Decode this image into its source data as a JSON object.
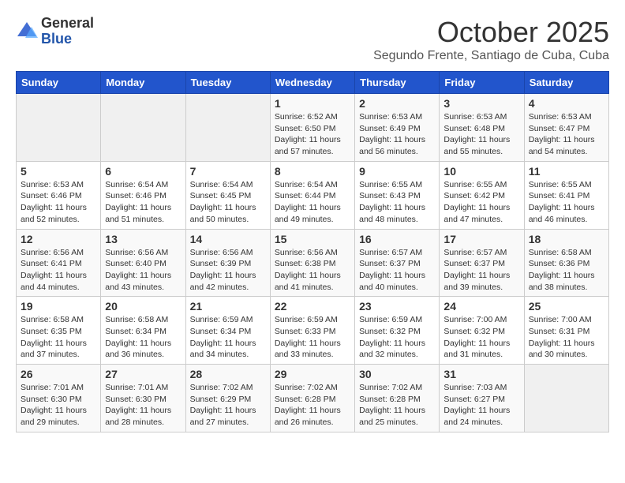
{
  "logo": {
    "general": "General",
    "blue": "Blue"
  },
  "title": "October 2025",
  "subtitle": "Segundo Frente, Santiago de Cuba, Cuba",
  "days_of_week": [
    "Sunday",
    "Monday",
    "Tuesday",
    "Wednesday",
    "Thursday",
    "Friday",
    "Saturday"
  ],
  "weeks": [
    [
      {
        "day": "",
        "info": ""
      },
      {
        "day": "",
        "info": ""
      },
      {
        "day": "",
        "info": ""
      },
      {
        "day": "1",
        "info": "Sunrise: 6:52 AM\nSunset: 6:50 PM\nDaylight: 11 hours\nand 57 minutes."
      },
      {
        "day": "2",
        "info": "Sunrise: 6:53 AM\nSunset: 6:49 PM\nDaylight: 11 hours\nand 56 minutes."
      },
      {
        "day": "3",
        "info": "Sunrise: 6:53 AM\nSunset: 6:48 PM\nDaylight: 11 hours\nand 55 minutes."
      },
      {
        "day": "4",
        "info": "Sunrise: 6:53 AM\nSunset: 6:47 PM\nDaylight: 11 hours\nand 54 minutes."
      }
    ],
    [
      {
        "day": "5",
        "info": "Sunrise: 6:53 AM\nSunset: 6:46 PM\nDaylight: 11 hours\nand 52 minutes."
      },
      {
        "day": "6",
        "info": "Sunrise: 6:54 AM\nSunset: 6:46 PM\nDaylight: 11 hours\nand 51 minutes."
      },
      {
        "day": "7",
        "info": "Sunrise: 6:54 AM\nSunset: 6:45 PM\nDaylight: 11 hours\nand 50 minutes."
      },
      {
        "day": "8",
        "info": "Sunrise: 6:54 AM\nSunset: 6:44 PM\nDaylight: 11 hours\nand 49 minutes."
      },
      {
        "day": "9",
        "info": "Sunrise: 6:55 AM\nSunset: 6:43 PM\nDaylight: 11 hours\nand 48 minutes."
      },
      {
        "day": "10",
        "info": "Sunrise: 6:55 AM\nSunset: 6:42 PM\nDaylight: 11 hours\nand 47 minutes."
      },
      {
        "day": "11",
        "info": "Sunrise: 6:55 AM\nSunset: 6:41 PM\nDaylight: 11 hours\nand 46 minutes."
      }
    ],
    [
      {
        "day": "12",
        "info": "Sunrise: 6:56 AM\nSunset: 6:41 PM\nDaylight: 11 hours\nand 44 minutes."
      },
      {
        "day": "13",
        "info": "Sunrise: 6:56 AM\nSunset: 6:40 PM\nDaylight: 11 hours\nand 43 minutes."
      },
      {
        "day": "14",
        "info": "Sunrise: 6:56 AM\nSunset: 6:39 PM\nDaylight: 11 hours\nand 42 minutes."
      },
      {
        "day": "15",
        "info": "Sunrise: 6:56 AM\nSunset: 6:38 PM\nDaylight: 11 hours\nand 41 minutes."
      },
      {
        "day": "16",
        "info": "Sunrise: 6:57 AM\nSunset: 6:37 PM\nDaylight: 11 hours\nand 40 minutes."
      },
      {
        "day": "17",
        "info": "Sunrise: 6:57 AM\nSunset: 6:37 PM\nDaylight: 11 hours\nand 39 minutes."
      },
      {
        "day": "18",
        "info": "Sunrise: 6:58 AM\nSunset: 6:36 PM\nDaylight: 11 hours\nand 38 minutes."
      }
    ],
    [
      {
        "day": "19",
        "info": "Sunrise: 6:58 AM\nSunset: 6:35 PM\nDaylight: 11 hours\nand 37 minutes."
      },
      {
        "day": "20",
        "info": "Sunrise: 6:58 AM\nSunset: 6:34 PM\nDaylight: 11 hours\nand 36 minutes."
      },
      {
        "day": "21",
        "info": "Sunrise: 6:59 AM\nSunset: 6:34 PM\nDaylight: 11 hours\nand 34 minutes."
      },
      {
        "day": "22",
        "info": "Sunrise: 6:59 AM\nSunset: 6:33 PM\nDaylight: 11 hours\nand 33 minutes."
      },
      {
        "day": "23",
        "info": "Sunrise: 6:59 AM\nSunset: 6:32 PM\nDaylight: 11 hours\nand 32 minutes."
      },
      {
        "day": "24",
        "info": "Sunrise: 7:00 AM\nSunset: 6:32 PM\nDaylight: 11 hours\nand 31 minutes."
      },
      {
        "day": "25",
        "info": "Sunrise: 7:00 AM\nSunset: 6:31 PM\nDaylight: 11 hours\nand 30 minutes."
      }
    ],
    [
      {
        "day": "26",
        "info": "Sunrise: 7:01 AM\nSunset: 6:30 PM\nDaylight: 11 hours\nand 29 minutes."
      },
      {
        "day": "27",
        "info": "Sunrise: 7:01 AM\nSunset: 6:30 PM\nDaylight: 11 hours\nand 28 minutes."
      },
      {
        "day": "28",
        "info": "Sunrise: 7:02 AM\nSunset: 6:29 PM\nDaylight: 11 hours\nand 27 minutes."
      },
      {
        "day": "29",
        "info": "Sunrise: 7:02 AM\nSunset: 6:28 PM\nDaylight: 11 hours\nand 26 minutes."
      },
      {
        "day": "30",
        "info": "Sunrise: 7:02 AM\nSunset: 6:28 PM\nDaylight: 11 hours\nand 25 minutes."
      },
      {
        "day": "31",
        "info": "Sunrise: 7:03 AM\nSunset: 6:27 PM\nDaylight: 11 hours\nand 24 minutes."
      },
      {
        "day": "",
        "info": ""
      }
    ]
  ]
}
